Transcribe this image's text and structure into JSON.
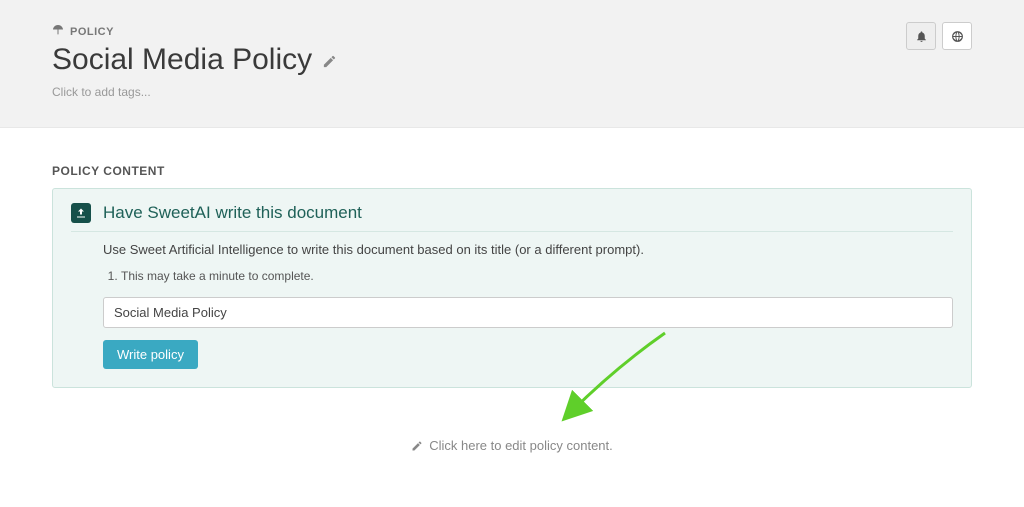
{
  "header": {
    "breadcrumb_label": "POLICY",
    "title": "Social Media Policy",
    "tags_placeholder": "Click to add tags..."
  },
  "section": {
    "heading": "POLICY CONTENT"
  },
  "ai_panel": {
    "title": "Have SweetAI write this document",
    "description": "Use Sweet Artificial Intelligence to write this document based on its title (or a different prompt).",
    "note_1": "This may take a minute to complete.",
    "input_value": "Social Media Policy",
    "button_label": "Write policy"
  },
  "edit_link": {
    "label": "Click here to edit policy content."
  },
  "colors": {
    "panel_bg": "#eef6f4",
    "panel_border": "#cbe3dc",
    "accent_teal": "#1f6158",
    "button_blue": "#3aa9c2",
    "arrow_green": "#5fcf2a"
  }
}
